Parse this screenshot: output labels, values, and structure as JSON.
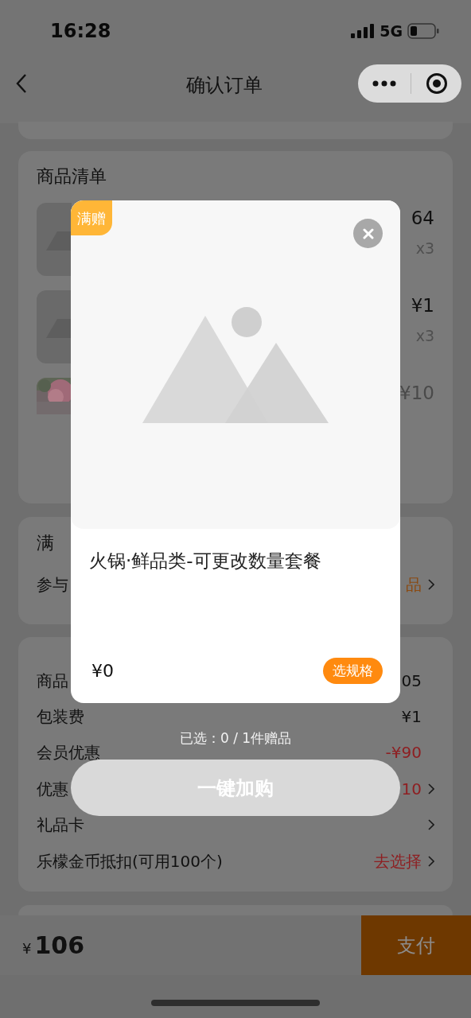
{
  "status_bar": {
    "time": "16:28",
    "network": "5G"
  },
  "nav": {
    "title": "确认订单"
  },
  "items_card": {
    "title": "商品清单",
    "items": [
      {
        "kind": "placeholder",
        "price": "64",
        "qty": "x3",
        "muted": false
      },
      {
        "kind": "placeholder",
        "price": "¥1",
        "qty": "x3",
        "muted": false
      },
      {
        "kind": "picture",
        "price": "¥10",
        "muted": true
      }
    ]
  },
  "gift_card": {
    "title": "满",
    "row_label": "参与",
    "row_value": "品"
  },
  "cost_rows": [
    {
      "label": "商品",
      "value": "05",
      "highlight": false,
      "chevron": false
    },
    {
      "label": "包装费",
      "value": "¥1",
      "highlight": false,
      "chevron": false
    },
    {
      "label": "会员优惠",
      "value": "-¥90",
      "highlight": true,
      "chevron": false
    },
    {
      "label": "优惠",
      "value": "10",
      "highlight": true,
      "chevron": true
    },
    {
      "label": "礼品卡",
      "chevron": true
    },
    {
      "label": "乐檬金币抵扣(可用100个)",
      "value": "去选择",
      "highlight": true,
      "chevron": true
    }
  ],
  "footer": {
    "currency": "¥",
    "total": "106",
    "pay": "支付"
  },
  "modal": {
    "badge": "满赠",
    "title": "火锅·鲜品类-可更改数量套餐",
    "price": "¥0",
    "spec_button": "选规格",
    "selected_text": "已选：0 / 1件赠品",
    "add_button": {
      "label": "一键加购",
      "disabled": true
    }
  }
}
